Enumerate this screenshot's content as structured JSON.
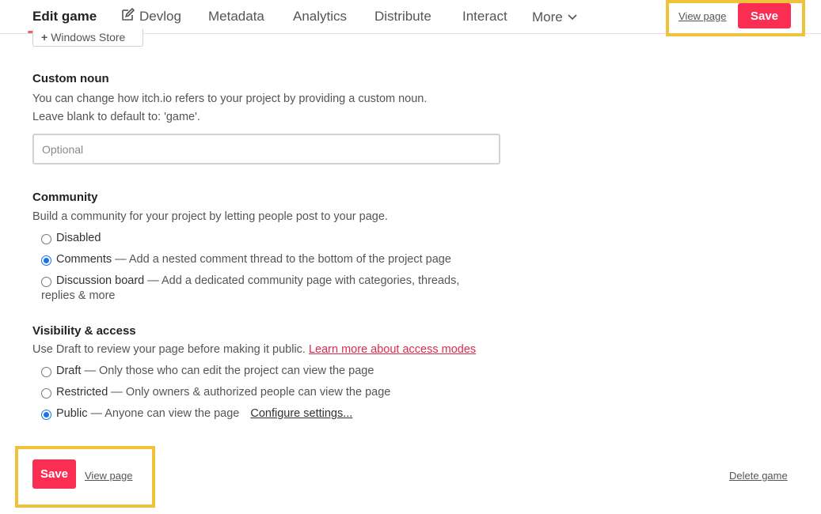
{
  "nav": {
    "tabs": [
      {
        "label": "Edit game",
        "active": true
      },
      {
        "label": "Devlog",
        "icon": "edit-icon"
      },
      {
        "label": "Metadata"
      },
      {
        "label": "Analytics"
      },
      {
        "label": "Distribute"
      },
      {
        "label": "Interact"
      },
      {
        "label": "More",
        "icon": "chevron-down-icon"
      }
    ],
    "view_page": "View page",
    "save": "Save"
  },
  "store_button": {
    "label": "Windows Store",
    "icon": "plus-icon"
  },
  "custom_noun": {
    "title": "Custom noun",
    "desc1": "You can change how itch.io refers to your project by providing a custom noun.",
    "desc2": "Leave blank to default to: 'game'.",
    "placeholder": "Optional",
    "value": ""
  },
  "community": {
    "title": "Community",
    "desc": "Build a community for your project by letting people post to your page.",
    "options": [
      {
        "label": "Disabled",
        "detail": "",
        "checked": false
      },
      {
        "label": "Comments",
        "detail": " — Add a nested comment thread to the bottom of the project page",
        "checked": true
      },
      {
        "label": "Discussion board",
        "detail": " — Add a dedicated community page with categories, threads,",
        "detail2": "replies & more",
        "checked": false
      }
    ]
  },
  "visibility": {
    "title": "Visibility & access",
    "desc": "Use Draft to review your page before making it public.",
    "learn_more": "Learn more about access modes",
    "options": [
      {
        "label": "Draft",
        "detail": " — Only those who can edit the project can view the page",
        "checked": false
      },
      {
        "label": "Restricted",
        "detail": " — Only owners & authorized people can view the page",
        "checked": false
      },
      {
        "label": "Public",
        "detail": " — Anyone can view the page",
        "checked": true,
        "extra_link": "Configure settings..."
      }
    ]
  },
  "footer": {
    "save": "Save",
    "view_page": "View page",
    "delete": "Delete game"
  },
  "colors": {
    "accent": "#fa2d52",
    "highlight": "#f0c13a",
    "link_red": "#da2c4f",
    "radio_blue": "#1a73e8"
  }
}
